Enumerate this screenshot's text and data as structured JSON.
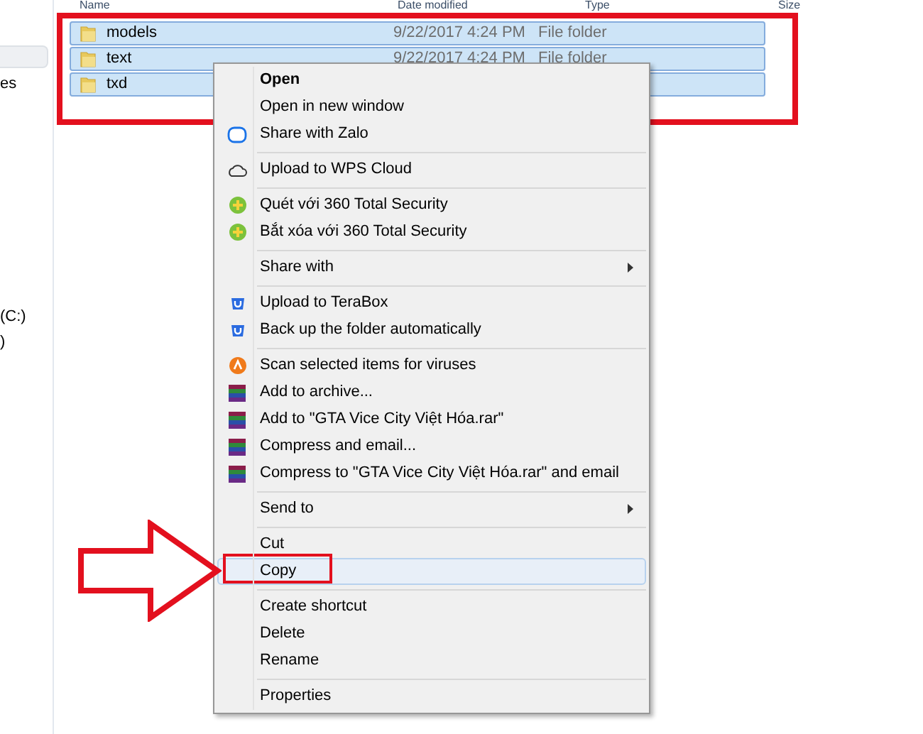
{
  "sidebar": {
    "items": [
      {
        "label": "es"
      },
      {
        "label": "(C:)"
      },
      {
        "label": ")"
      }
    ]
  },
  "table": {
    "columns": [
      "Name",
      "Date modified",
      "Type",
      "Size"
    ],
    "rows": [
      {
        "name": "models",
        "date_modified": "9/22/2017 4:24 PM",
        "type": "File folder",
        "selected": true
      },
      {
        "name": "text",
        "date_modified": "9/22/2017 4:24 PM",
        "type": "File folder",
        "selected": true
      },
      {
        "name": "txd",
        "selected": true
      }
    ]
  },
  "context_menu": {
    "items": [
      {
        "kind": "plain",
        "label": "Open",
        "bold": true
      },
      {
        "kind": "plain",
        "label": "Open in new window"
      },
      {
        "kind": "zalo",
        "label": "Share with Zalo"
      },
      {
        "kind": "separator"
      },
      {
        "kind": "cloud",
        "label": "Upload to WPS Cloud"
      },
      {
        "kind": "separator"
      },
      {
        "kind": "security",
        "label": "Quét với 360 Total Security"
      },
      {
        "kind": "security",
        "label": "Bắt xóa với 360 Total Security"
      },
      {
        "kind": "separator"
      },
      {
        "kind": "submenu",
        "label": "Share with"
      },
      {
        "kind": "separator"
      },
      {
        "kind": "terabox",
        "label": "Upload to TeraBox"
      },
      {
        "kind": "terabox",
        "label": "Back up the folder automatically"
      },
      {
        "kind": "separator"
      },
      {
        "kind": "antivirus",
        "label": "Scan selected items for viruses"
      },
      {
        "kind": "archive",
        "label": "Add to archive..."
      },
      {
        "kind": "archive",
        "label": "Add to \"GTA Vice City Việt Hóa.rar\""
      },
      {
        "kind": "archive",
        "label": "Compress and email..."
      },
      {
        "kind": "archive",
        "label": "Compress to \"GTA Vice City Việt Hóa.rar\" and email"
      },
      {
        "kind": "separator"
      },
      {
        "kind": "submenu",
        "label": "Send to"
      },
      {
        "kind": "separator"
      },
      {
        "kind": "plain",
        "label": "Cut"
      },
      {
        "kind": "plain",
        "label": "Copy",
        "selected": true
      },
      {
        "kind": "separator"
      },
      {
        "kind": "plain",
        "label": "Create shortcut"
      },
      {
        "kind": "plain",
        "label": "Delete"
      },
      {
        "kind": "plain",
        "label": "Rename"
      },
      {
        "kind": "separator"
      },
      {
        "kind": "plain",
        "label": "Properties"
      }
    ]
  }
}
